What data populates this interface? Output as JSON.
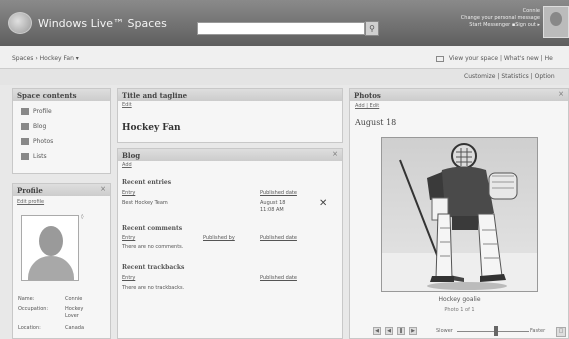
{
  "header": {
    "brand": "Windows Live™ Spaces",
    "user_name": "Connie",
    "user_line2": "Change your personal message",
    "user_line3": "Start Messenger ▪Sign out ▸"
  },
  "breadcrumb": {
    "crumbs": "Spaces  ›  Hockey Fan  ▾",
    "links": "View your space  |  What's new  |  He"
  },
  "customize_bar": {
    "links": "Customize  |  Statistics  |  Option"
  },
  "space_contents": {
    "title": "Space contents",
    "items": [
      {
        "label": "Profile"
      },
      {
        "label": "Blog"
      },
      {
        "label": "Photos"
      },
      {
        "label": "Lists"
      }
    ]
  },
  "profile": {
    "title": "Profile",
    "close": "×",
    "edit": "Edit profile",
    "name_label": "Name:",
    "name_value": "Connie",
    "occupation_label": "Occupation:",
    "occupation_value": "Hockey Lover",
    "location_label": "Location:",
    "location_value": "Canada"
  },
  "title_panel": {
    "title": "Title and tagline",
    "edit": "Edit",
    "space_title": "Hockey Fan"
  },
  "blog": {
    "title": "Blog",
    "close": "×",
    "add": "Add",
    "recent_entries": "Recent entries",
    "entry_col": "Entry",
    "published_col": "Published date",
    "entry_title": "Best Hockey Team",
    "entry_date": "August 18",
    "entry_time": "11:08 AM",
    "recent_comments": "Recent comments",
    "published_by_col": "Published by",
    "no_comments": "There are no comments.",
    "recent_trackbacks": "Recent trackbacks",
    "no_trackbacks": "There are no trackbacks."
  },
  "photos": {
    "title": "Photos",
    "close": "×",
    "actions": "Add  |  Edit",
    "album_date": "August 18",
    "caption": "Hockey goalie",
    "counter": "Photo 1 of 1",
    "slower": "Slower",
    "faster": "Faster"
  }
}
